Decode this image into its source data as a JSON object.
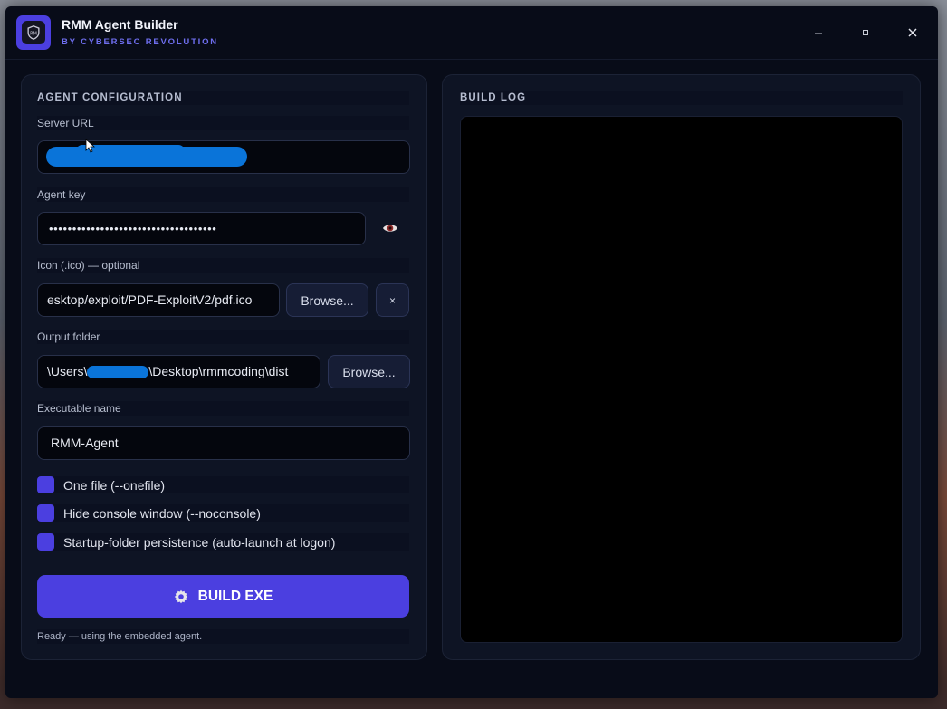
{
  "app": {
    "title": "RMM Agent Builder",
    "subtitle": "BY CYBERSEC REVOLUTION",
    "logo_icon": "shield-icon",
    "controls": {
      "minimize": "–",
      "maximize": "▫",
      "close": "✕"
    }
  },
  "config": {
    "section_title": "AGENT CONFIGURATION",
    "server_url": {
      "label": "Server URL",
      "value": ""
    },
    "agent_key": {
      "label": "Agent key",
      "value": "••••••••••••••••••••••••••••••••••••",
      "reveal_icon": "eye-icon"
    },
    "icon": {
      "label": "Icon (.ico) — optional",
      "value": "esktop/exploit/PDF-ExploitV2/pdf.ico",
      "browse_label": "Browse...",
      "clear_label": "×"
    },
    "output": {
      "label": "Output folder",
      "value_prefix": "\\Users\\",
      "value_suffix": "\\Desktop\\rmmcoding\\dist",
      "browse_label": "Browse..."
    },
    "exe_name": {
      "label": "Executable name",
      "value": "RMM-Agent"
    },
    "options": [
      {
        "label": "One file (--onefile)",
        "checked": true
      },
      {
        "label": "Hide console window (--noconsole)",
        "checked": true
      },
      {
        "label": "Startup-folder persistence (auto-launch at logon)",
        "checked": true
      }
    ],
    "build_label": "BUILD EXE",
    "build_icon": "gear-icon",
    "status": "Ready — using the embedded agent."
  },
  "log": {
    "section_title": "BUILD LOG",
    "content": ""
  },
  "colors": {
    "accent": "#4b3fe0",
    "subtitle": "#6f6ff0",
    "window_bg": "#080c18",
    "panel_bg": "#0e1424",
    "redaction": "#0a74d9"
  }
}
